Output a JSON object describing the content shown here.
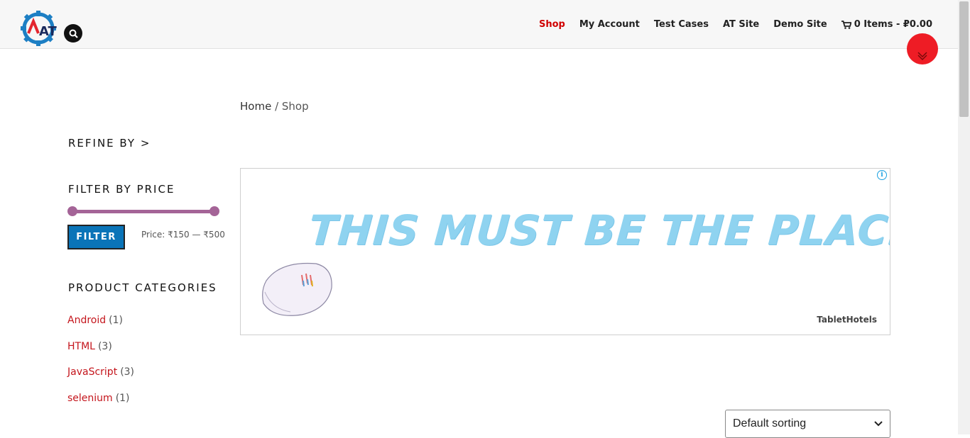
{
  "header": {
    "nav": [
      {
        "label": "Shop",
        "active": true
      },
      {
        "label": "My Account"
      },
      {
        "label": "Test Cases"
      },
      {
        "label": "AT Site"
      },
      {
        "label": "Demo Site"
      }
    ],
    "cart_label": "0 Items - ₽0.00",
    "logo_text": "AT",
    "icons": {
      "search": "search-icon",
      "cart": "cart-icon",
      "scroll": "chevron-down-icon"
    }
  },
  "breadcrumb": {
    "home": "Home",
    "separator": " / ",
    "current": "Shop"
  },
  "sidebar": {
    "refine_title": "REFINE BY >",
    "filter_title": "FILTER BY PRICE",
    "filter_button": "FILTER",
    "price_label": "Price: ₹150 — ₹500",
    "price_range": {
      "min": 150,
      "max": 500,
      "selected_min": 150,
      "selected_max": 500
    },
    "categories_title": "PRODUCT CATEGORIES",
    "categories": [
      {
        "name": "Android",
        "count": "(1)"
      },
      {
        "name": "HTML",
        "count": "(3)"
      },
      {
        "name": "JavaScript",
        "count": "(3)"
      },
      {
        "name": "selenium",
        "count": "(1)"
      }
    ]
  },
  "ad": {
    "headline": "THIS MUST BE THE PLACE",
    "brand": "TabletHotels",
    "info_icon": "i"
  },
  "sorting": {
    "selected": "Default sorting"
  },
  "colors": {
    "accent_red": "#d00000",
    "slider": "#a46497",
    "button_blue": "#0a74b8",
    "category_link": "#c4151c"
  }
}
